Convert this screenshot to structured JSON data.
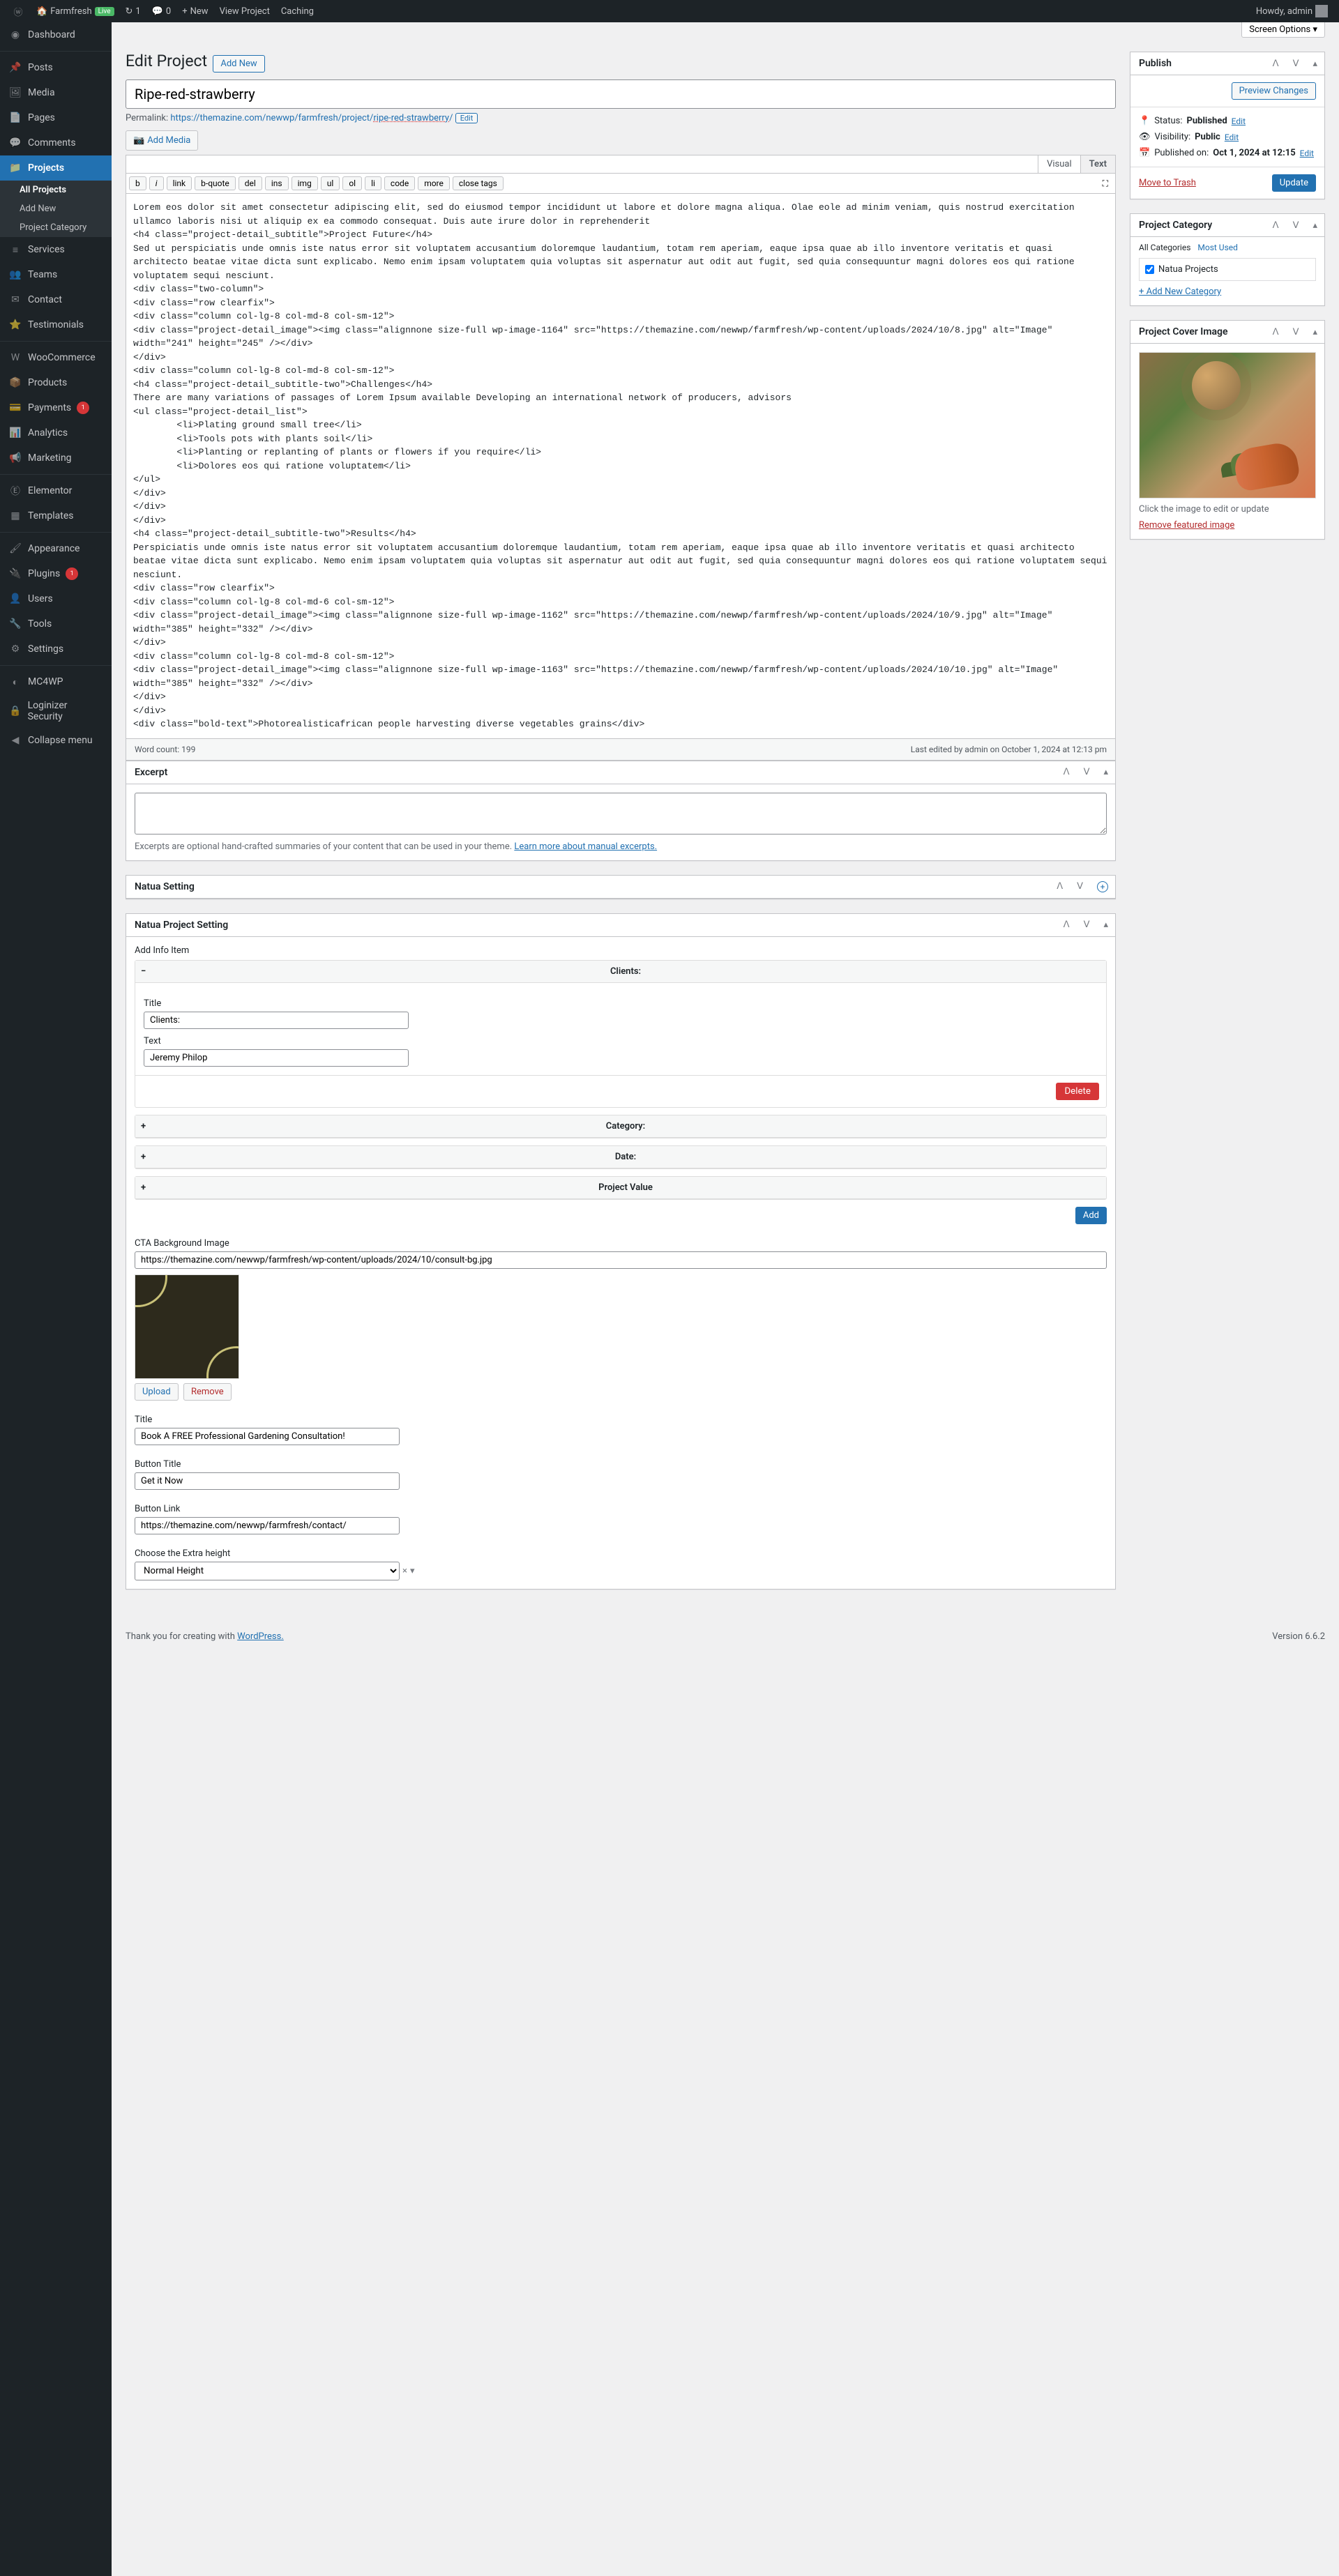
{
  "toolbar": {
    "site": "Farmfresh",
    "live": "Live",
    "updates": "1",
    "comments": "0",
    "new": "New",
    "view": "View Project",
    "caching": "Caching",
    "howdy": "Howdy, admin"
  },
  "screen_options": "Screen Options ▾",
  "sidebar": {
    "dashboard": "Dashboard",
    "posts": "Posts",
    "media": "Media",
    "pages": "Pages",
    "comments": "Comments",
    "projects": "Projects",
    "projects_sub": {
      "all": "All Projects",
      "add": "Add New",
      "cat": "Project Category"
    },
    "services": "Services",
    "teams": "Teams",
    "contact": "Contact",
    "testimonials": "Testimonials",
    "woo": "WooCommerce",
    "products": "Products",
    "payments": "Payments",
    "payments_badge": "1",
    "analytics": "Analytics",
    "marketing": "Marketing",
    "elementor": "Elementor",
    "templates": "Templates",
    "appearance": "Appearance",
    "plugins": "Plugins",
    "plugins_badge": "1",
    "users": "Users",
    "tools": "Tools",
    "settings": "Settings",
    "mc4wp": "MC4WP",
    "loginizer": "Loginizer Security",
    "collapse": "Collapse menu"
  },
  "heading": "Edit Project",
  "add_new": "Add New",
  "post_title": "Ripe-red-strawberry",
  "permalink": {
    "label": "Permalink:",
    "base": "https://themazine.com/newwp/farmfresh/project/",
    "slug": "ripe-red-strawberry",
    "edit": "Edit"
  },
  "media_btn": "Add Media",
  "visual_tab": "Visual",
  "text_tab": "Text",
  "quicktags": [
    "b",
    "i",
    "link",
    "b-quote",
    "del",
    "ins",
    "img",
    "ul",
    "ol",
    "li",
    "code",
    "more",
    "close tags"
  ],
  "editor_content": "Lorem eos dolor sit amet consectetur adipiscing elit, sed do eiusmod tempor incididunt ut labore et dolore magna aliqua. Olae eole ad minim veniam, quis nostrud exercitation ullamco laboris nisi ut aliquip ex ea commodo consequat. Duis aute irure dolor in reprehenderit\n<h4 class=\"project-detail_subtitle\">Project Future</h4>\nSed ut perspiciatis unde omnis iste natus error sit voluptatem accusantium doloremque laudantium, totam rem aperiam, eaque ipsa quae ab illo inventore veritatis et quasi architecto beatae vitae dicta sunt explicabo. Nemo enim ipsam voluptatem quia voluptas sit aspernatur aut odit aut fugit, sed quia consequuntur magni dolores eos qui ratione voluptatem sequi nesciunt.\n<div class=\"two-column\">\n<div class=\"row clearfix\">\n<div class=\"column col-lg-8 col-md-8 col-sm-12\">\n<div class=\"project-detail_image\"><img class=\"alignnone size-full wp-image-1164\" src=\"https://themazine.com/newwp/farmfresh/wp-content/uploads/2024/10/8.jpg\" alt=\"Image\" width=\"241\" height=\"245\" /></div>\n</div>\n<div class=\"column col-lg-8 col-md-8 col-sm-12\">\n<h4 class=\"project-detail_subtitle-two\">Challenges</h4>\nThere are many variations of passages of Lorem Ipsum available Developing an international network of producers, advisors\n<ul class=\"project-detail_list\">\n \t<li>Plating ground small tree</li>\n \t<li>Tools pots with plants soil</li>\n \t<li>Planting or replanting of plants or flowers if you require</li>\n \t<li>Dolores eos qui ratione voluptatem</li>\n</ul>\n</div>\n</div>\n</div>\n<h4 class=\"project-detail_subtitle-two\">Results</h4>\nPerspiciatis unde omnis iste natus error sit voluptatem accusantium doloremque laudantium, totam rem aperiam, eaque ipsa quae ab illo inventore veritatis et quasi architecto beatae vitae dicta sunt explicabo. Nemo enim ipsam voluptatem quia voluptas sit aspernatur aut odit aut fugit, sed quia consequuntur magni dolores eos qui ratione voluptatem sequi nesciunt.\n<div class=\"row clearfix\">\n<div class=\"column col-lg-8 col-md-6 col-sm-12\">\n<div class=\"project-detail_image\"><img class=\"alignnone size-full wp-image-1162\" src=\"https://themazine.com/newwp/farmfresh/wp-content/uploads/2024/10/9.jpg\" alt=\"Image\" width=\"385\" height=\"332\" /></div>\n</div>\n<div class=\"column col-lg-8 col-md-8 col-sm-12\">\n<div class=\"project-detail_image\"><img class=\"alignnone size-full wp-image-1163\" src=\"https://themazine.com/newwp/farmfresh/wp-content/uploads/2024/10/10.jpg\" alt=\"Image\" width=\"385\" height=\"332\" /></div>\n</div>\n</div>\n<div class=\"bold-text\">Photorealisticafrican people harvesting diverse vegetables grains</div>",
  "word_count": "Word count: 199",
  "last_edited": "Last edited by admin on October 1, 2024 at 12:13 pm",
  "excerpt": {
    "title": "Excerpt",
    "desc": "Excerpts are optional hand-crafted summaries of your content that can be used in your theme. ",
    "link": "Learn more about manual excerpts."
  },
  "natua": {
    "title": "Natua Setting",
    "sub": "Natua Project Setting",
    "add_info": "Add Info Item",
    "items": [
      {
        "name": "Clients:",
        "expanded": true,
        "title_label": "Title",
        "title_val": "Clients:",
        "text_label": "Text",
        "text_val": "Jeremy Philop"
      },
      {
        "name": "Category:",
        "expanded": false
      },
      {
        "name": "Date:",
        "expanded": false
      },
      {
        "name": "Project Value",
        "expanded": false
      }
    ],
    "delete": "Delete",
    "add": "Add",
    "cta_label": "CTA Background Image",
    "cta_url": "https://themazine.com/newwp/farmfresh/wp-content/uploads/2024/10/consult-bg.jpg",
    "upload": "Upload",
    "remove": "Remove",
    "title_label": "Title",
    "title_val": "Book A FREE Professional Gardening Consultation!",
    "btn_title_label": "Button Title",
    "btn_title_val": "Get it Now",
    "btn_link_label": "Button Link",
    "btn_link_val": "https://themazine.com/newwp/farmfresh/contact/",
    "height_label": "Choose the Extra height",
    "height_val": "Normal Height"
  },
  "publish": {
    "title": "Publish",
    "preview": "Preview Changes",
    "status_label": "Status:",
    "status": "Published",
    "edit": "Edit",
    "vis_label": "Visibility:",
    "vis": "Public",
    "pub_label": "Published on:",
    "pub": "Oct 1, 2024 at 12:15",
    "trash": "Move to Trash",
    "update": "Update"
  },
  "category": {
    "title": "Project Category",
    "tab_all": "All Categories",
    "tab_used": "Most Used",
    "item": "Natua Projects",
    "add": "+ Add New Category"
  },
  "cover": {
    "title": "Project Cover Image",
    "desc": "Click the image to edit or update",
    "remove": "Remove featured image"
  },
  "footer": {
    "thanks": "Thank you for creating with ",
    "wp": "WordPress.",
    "ver": "Version 6.6.2"
  }
}
